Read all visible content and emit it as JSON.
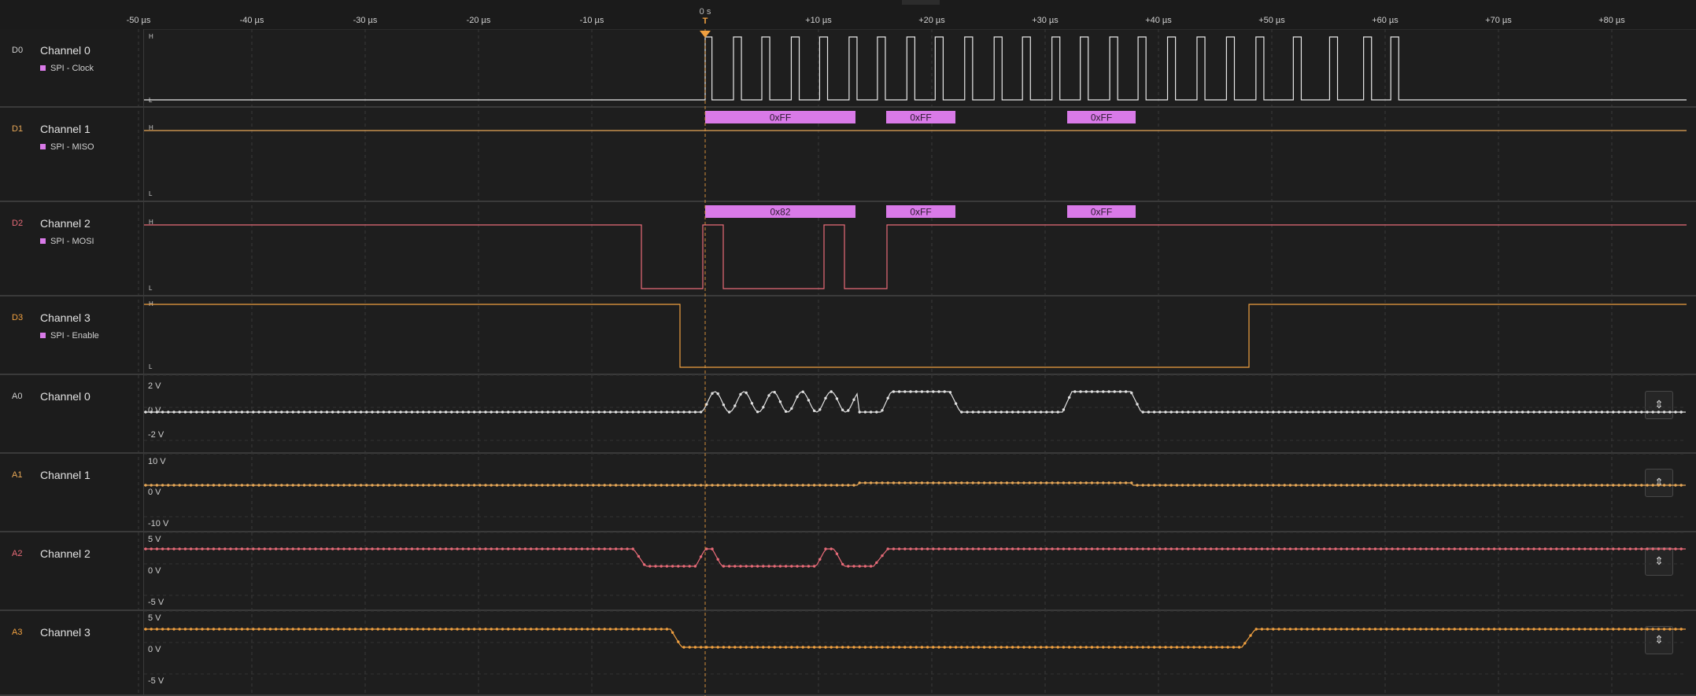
{
  "time_axis": {
    "ticks": [
      {
        "t": -50,
        "label": "-50 µs"
      },
      {
        "t": -40,
        "label": "-40 µs"
      },
      {
        "t": -30,
        "label": "-30 µs"
      },
      {
        "t": -20,
        "label": "-20 µs"
      },
      {
        "t": -10,
        "label": "-10 µs"
      },
      {
        "t": 10,
        "label": "+10 µs"
      },
      {
        "t": 20,
        "label": "+20 µs"
      },
      {
        "t": 30,
        "label": "+30 µs"
      },
      {
        "t": 40,
        "label": "+40 µs"
      },
      {
        "t": 50,
        "label": "+50 µs"
      },
      {
        "t": 60,
        "label": "+60 µs"
      },
      {
        "t": 70,
        "label": "+70 µs"
      },
      {
        "t": 80,
        "label": "+80 µs"
      }
    ],
    "zero_label": "0 s",
    "trigger_label": "T",
    "trigger_color": "#f0a040"
  },
  "digital": [
    {
      "id": "D0",
      "name": "Channel 0",
      "analyzer": "SPI - Clock",
      "color": "#e8e8e8",
      "high_label": "H",
      "low_label": "L",
      "edges_us": [
        0,
        0.6,
        2.5,
        3.2,
        5.0,
        5.7,
        7.6,
        8.3,
        10.1,
        10.8,
        12.7,
        13.4,
        15.2,
        15.9,
        17.8,
        18.5,
        20.3,
        21.0,
        22.9,
        23.6,
        25.5,
        26.2,
        28.0,
        28.7,
        30.6,
        31.3,
        33.1,
        33.8,
        35.7,
        36.4,
        38.2,
        38.9,
        40.8,
        41.5,
        43.4,
        44.1,
        46.0,
        46.7,
        48.6,
        49.3,
        51.9,
        52.6,
        55.1,
        55.8,
        58.1,
        58.8,
        60.5,
        61.2
      ]
    },
    {
      "id": "D1",
      "name": "Channel 1",
      "analyzer": "SPI - MISO",
      "color": "#e8a857",
      "high_label": "H",
      "low_label": "L"
    },
    {
      "id": "D2",
      "name": "Channel 2",
      "analyzer": "SPI - MOSI",
      "color": "#e86b78",
      "high_label": "H",
      "low_label": "L"
    },
    {
      "id": "D3",
      "name": "Channel 3",
      "analyzer": "SPI - Enable",
      "color": "#f0a040",
      "high_label": "H",
      "low_label": "L"
    }
  ],
  "decoded": {
    "miso": [
      "0xFF",
      "0xFF",
      "0xFF"
    ],
    "mosi": [
      "0x82",
      "0xFF",
      "0xFF"
    ],
    "badge_color": "#d97ae8"
  },
  "analog": [
    {
      "id": "A0",
      "name": "Channel 0",
      "color": "#e0e0e0",
      "scale": [
        "2 V",
        "0 V",
        "-2 V"
      ]
    },
    {
      "id": "A1",
      "name": "Channel 1",
      "color": "#e8a857",
      "scale": [
        "10 V",
        "0 V",
        "-10 V"
      ]
    },
    {
      "id": "A2",
      "name": "Channel 2",
      "color": "#e86b78",
      "scale": [
        "5 V",
        "0 V",
        "-5 V"
      ]
    },
    {
      "id": "A3",
      "name": "Channel 3",
      "color": "#f0a040",
      "scale": [
        "5 V",
        "0 V",
        "-5 V"
      ]
    }
  ],
  "icons": {
    "autoscale": "autoscale-icon",
    "trigger": "trigger-marker-icon"
  }
}
